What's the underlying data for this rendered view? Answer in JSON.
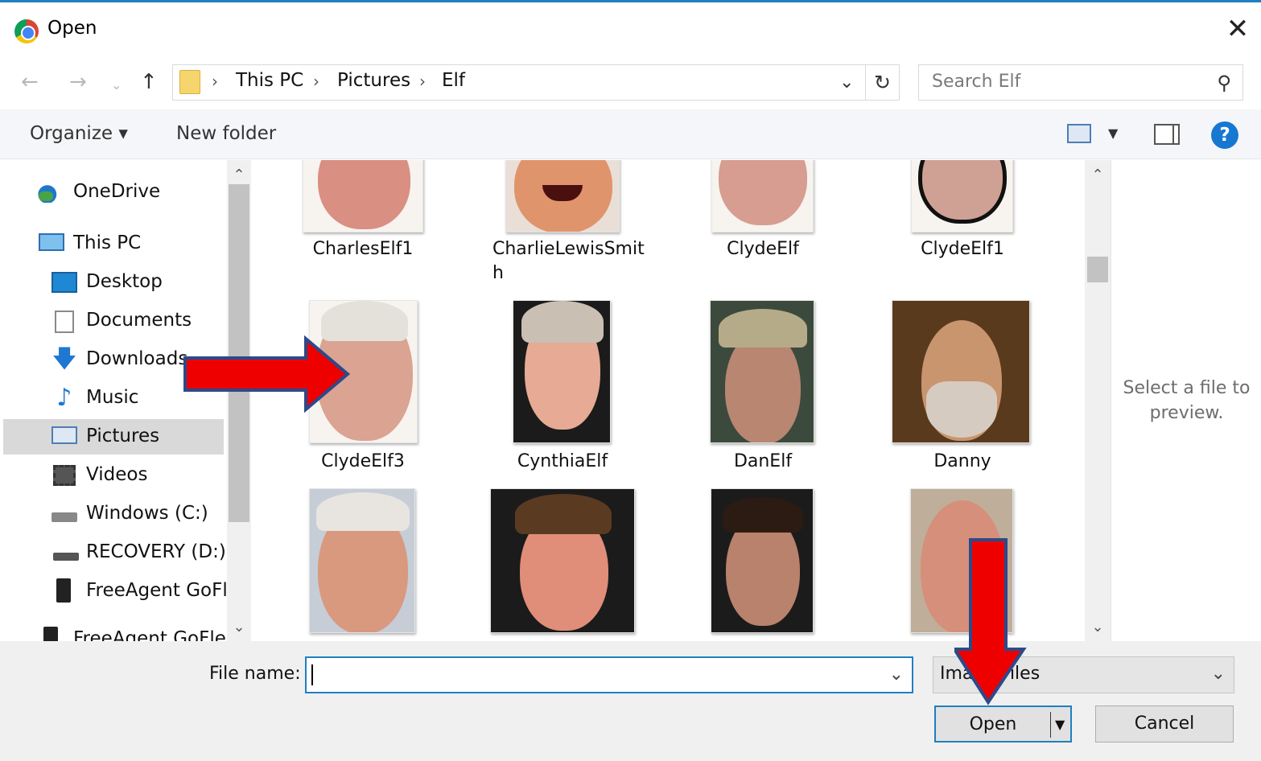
{
  "window": {
    "title": "Open",
    "close_glyph": "✕"
  },
  "nav": {
    "back": "←",
    "forward": "→",
    "recent": "⌄",
    "up": "↑"
  },
  "address": {
    "crumbs": [
      "This PC",
      "Pictures",
      "Elf"
    ],
    "separator": "›",
    "dropdown": "⌄",
    "refresh": "↻"
  },
  "search": {
    "placeholder": "Search Elf",
    "icon": "search-icon"
  },
  "toolbar": {
    "organize": "Organize ▾",
    "new_folder": "New folder",
    "help": "?"
  },
  "sidebar": {
    "items": [
      {
        "label": "OneDrive",
        "icon": "onedrive-icon"
      },
      {
        "label": "This PC",
        "icon": "this-pc-icon"
      },
      {
        "label": "Desktop",
        "icon": "desktop-icon"
      },
      {
        "label": "Documents",
        "icon": "documents-icon"
      },
      {
        "label": "Downloads",
        "icon": "downloads-icon"
      },
      {
        "label": "Music",
        "icon": "music-icon"
      },
      {
        "label": "Pictures",
        "icon": "pictures-icon",
        "selected": true
      },
      {
        "label": "Videos",
        "icon": "videos-icon"
      },
      {
        "label": "Windows (C:)",
        "icon": "drive-icon"
      },
      {
        "label": "RECOVERY (D:)",
        "icon": "drive-icon"
      },
      {
        "label": "FreeAgent GoFle",
        "icon": "external-drive-icon"
      },
      {
        "label": "FreeAgent GoFle...",
        "icon": "external-drive-icon"
      }
    ]
  },
  "files": [
    {
      "name": "CharlesElf1"
    },
    {
      "name": "CharlieLewisSmith"
    },
    {
      "name": "ClydeElf"
    },
    {
      "name": "ClydeElf1"
    },
    {
      "name": "ClydeElf3"
    },
    {
      "name": "CynthiaElf"
    },
    {
      "name": "DanElf"
    },
    {
      "name": "Danny"
    },
    {
      "name": ""
    },
    {
      "name": ""
    },
    {
      "name": ""
    },
    {
      "name": ""
    }
  ],
  "preview": {
    "text": "Select a file to preview."
  },
  "footer": {
    "file_name_label": "File name:",
    "file_name_value": "",
    "file_type": "Image Files",
    "open_label": "Open",
    "cancel_label": "Cancel"
  },
  "colors": {
    "accent": "#1f7fc2",
    "annotation_arrow": "#ee0000",
    "arrow_outline": "#2b4a8a"
  }
}
